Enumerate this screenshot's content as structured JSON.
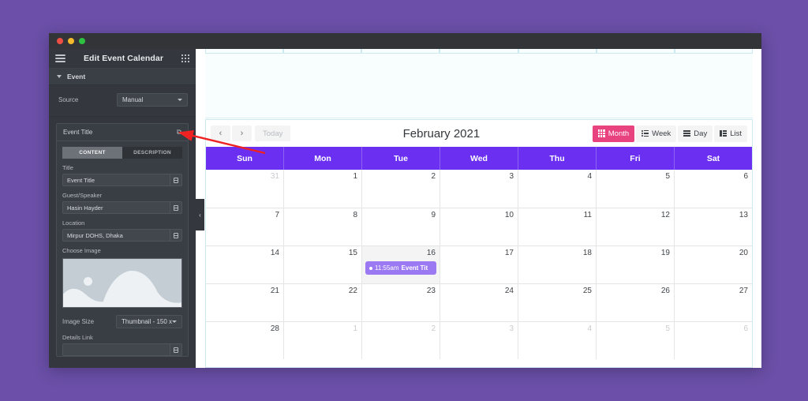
{
  "window": {
    "title": "Edit Event Calendar",
    "traffic_lights": [
      "close",
      "minimize",
      "maximize"
    ]
  },
  "panel": {
    "menu_icon": "hamburger-icon",
    "apps_icon": "grid-icon",
    "section": {
      "label": "Event",
      "caret": "caret-down-icon"
    },
    "source": {
      "label": "Source",
      "value": "Manual"
    },
    "repeater": {
      "title": "Event Title",
      "duplicate_icon": "copy-icon"
    },
    "tabs": [
      {
        "label": "CONTENT",
        "active": true
      },
      {
        "label": "DESCRIPTION",
        "active": false
      }
    ],
    "fields": [
      {
        "label": "Title",
        "value": "Event Title"
      },
      {
        "label": "Guest/Speaker",
        "value": "Hasin Hayder"
      },
      {
        "label": "Location",
        "value": "Mirpur DOHS, Dhaka"
      }
    ],
    "choose_image": {
      "label": "Choose Image"
    },
    "image_size": {
      "label": "Image Size",
      "value": "Thumbnail - 150 x"
    },
    "details_link": {
      "label": "Details Link"
    }
  },
  "canvas": {
    "collapse_handle_icon": "chevron-left-icon"
  },
  "calendar": {
    "prev_label": "‹",
    "next_label": "›",
    "today_label": "Today",
    "title": "February 2021",
    "views": [
      {
        "label": "Month",
        "icon": "grid-view-icon",
        "active": true
      },
      {
        "label": "Week",
        "icon": "list-dots-icon",
        "active": false
      },
      {
        "label": "Day",
        "icon": "lines-icon",
        "active": false
      },
      {
        "label": "List",
        "icon": "list-view-icon",
        "active": false
      }
    ],
    "weekdays": [
      "Sun",
      "Mon",
      "Tue",
      "Wed",
      "Thu",
      "Fri",
      "Sat"
    ],
    "header_color": "#6a2ff0",
    "accent_color": "#e8427f",
    "event_color": "#9b79f2",
    "weeks": [
      [
        {
          "day": "31",
          "other": true
        },
        {
          "day": "1"
        },
        {
          "day": "2"
        },
        {
          "day": "3"
        },
        {
          "day": "4"
        },
        {
          "day": "5"
        },
        {
          "day": "6"
        }
      ],
      [
        {
          "day": "7"
        },
        {
          "day": "8"
        },
        {
          "day": "9"
        },
        {
          "day": "10"
        },
        {
          "day": "11"
        },
        {
          "day": "12"
        },
        {
          "day": "13"
        }
      ],
      [
        {
          "day": "14"
        },
        {
          "day": "15"
        },
        {
          "day": "16",
          "today": true,
          "event": {
            "time": "11:55am",
            "title": "Event Tit"
          }
        },
        {
          "day": "17"
        },
        {
          "day": "18"
        },
        {
          "day": "19"
        },
        {
          "day": "20"
        }
      ],
      [
        {
          "day": "21"
        },
        {
          "day": "22"
        },
        {
          "day": "23"
        },
        {
          "day": "24"
        },
        {
          "day": "25"
        },
        {
          "day": "26"
        },
        {
          "day": "27"
        }
      ],
      [
        {
          "day": "28"
        },
        {
          "day": "1",
          "other": true
        },
        {
          "day": "2",
          "other": true
        },
        {
          "day": "3",
          "other": true
        },
        {
          "day": "4",
          "other": true
        },
        {
          "day": "5",
          "other": true
        },
        {
          "day": "6",
          "other": true
        }
      ]
    ]
  },
  "annotation": {
    "arrow_color": "#ee2222"
  }
}
